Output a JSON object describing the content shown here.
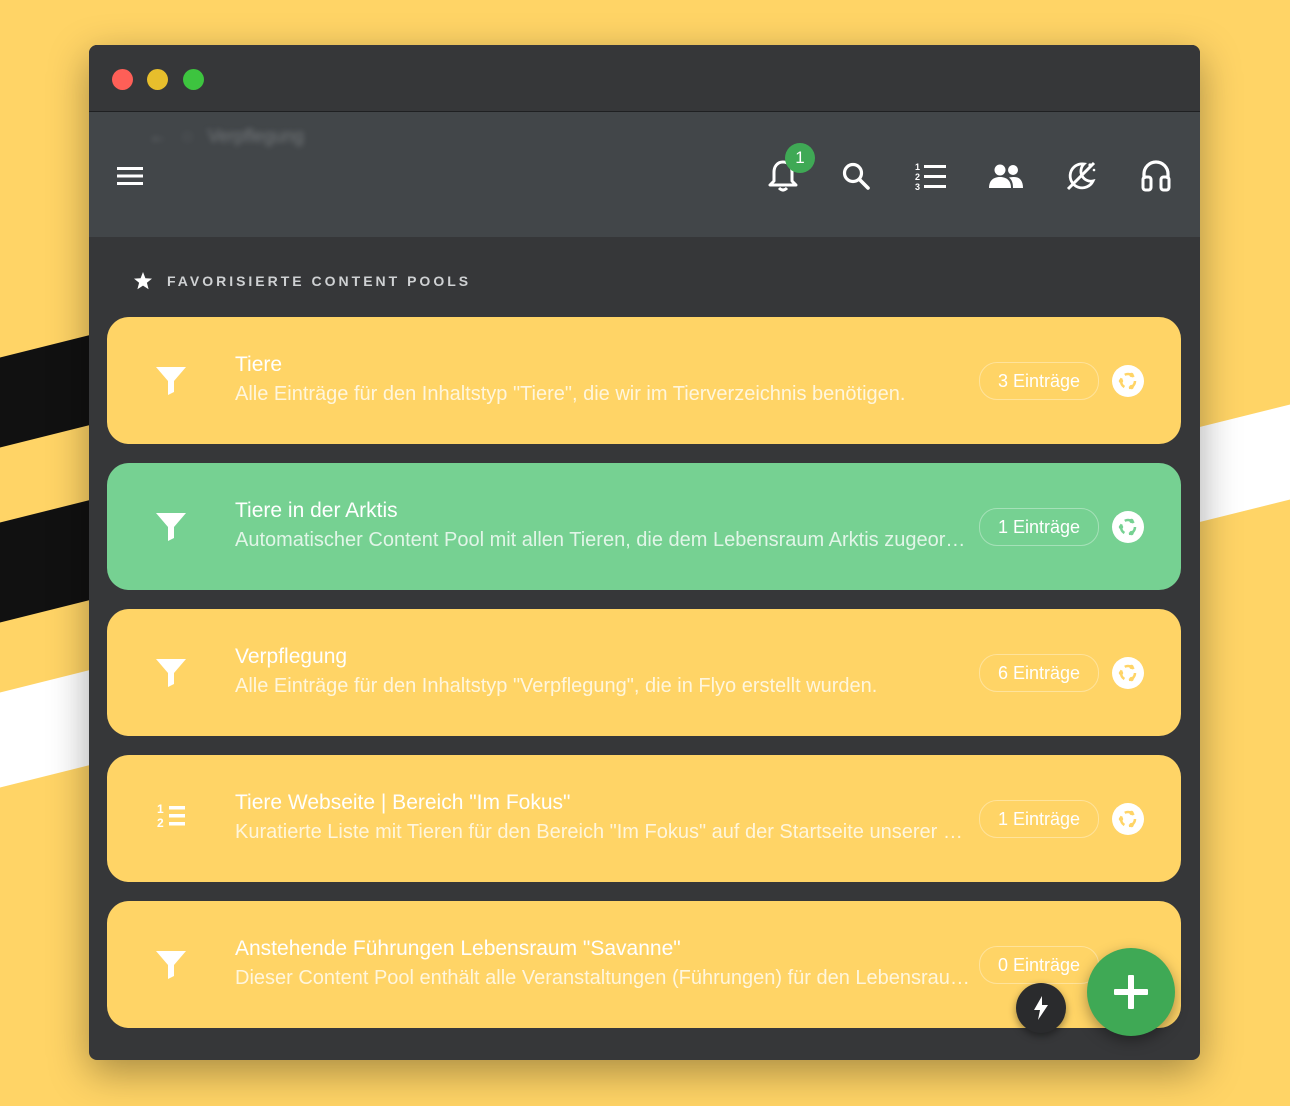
{
  "header": {
    "breadcrumb_ghost": "Verpflegung",
    "notification_count": "1"
  },
  "section": {
    "title": "FAVORISIERTE CONTENT POOLS"
  },
  "pools": [
    {
      "title": "Tiere",
      "description": "Alle Einträge für den Inhaltstyp \"Tiere\", die wir im Tierverzeichnis benötigen.",
      "count": "3 Einträge",
      "icon": "filter-icon",
      "active": false
    },
    {
      "title": "Tiere in der Arktis",
      "description": "Automatischer Content Pool mit allen Tieren, die dem Lebensraum Arktis zugeordnet sind.",
      "count": "1 Einträge",
      "icon": "filter-icon",
      "active": true
    },
    {
      "title": "Verpflegung",
      "description": "Alle Einträge für den Inhaltstyp \"Verpflegung\", die in Flyo erstellt wurden.",
      "count": "6 Einträge",
      "icon": "filter-icon",
      "active": false
    },
    {
      "title": "Tiere Webseite | Bereich \"Im Fokus\"",
      "description": "Kuratierte Liste mit Tieren für den Bereich \"Im Fokus\" auf der Startseite unserer Webseite.",
      "count": "1 Einträge",
      "icon": "ordered-list-icon",
      "active": false
    },
    {
      "title": "Anstehende Führungen Lebensraum \"Savanne\"",
      "description": "Dieser Content Pool enthält alle Veranstaltungen (Führungen) für den Lebensraum Savanne.",
      "count": "0 Einträge",
      "icon": "filter-icon",
      "active": false
    }
  ],
  "colors": {
    "background": "#FFD466",
    "card_default": "#FFD466",
    "card_active": "#76D192",
    "accent_green": "#3FA955",
    "window": "#363739",
    "appbar": "#424649"
  }
}
